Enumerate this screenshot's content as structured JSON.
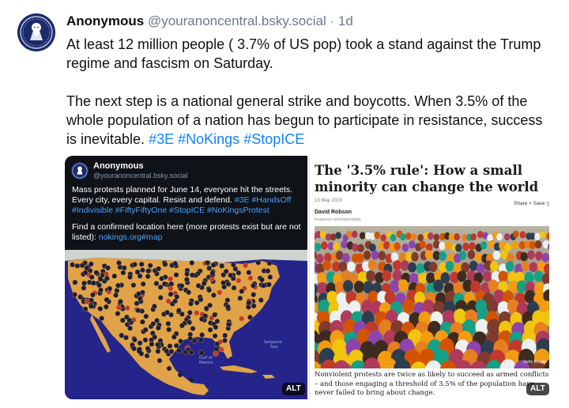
{
  "post": {
    "author_name": "Anonymous",
    "author_handle": "@youranoncentral.bsky.social",
    "separator": "·",
    "timestamp": "1d",
    "paragraph_1": "At least 12 million people ( 3.7% of US pop) took a stand against the Trump regime and fascism on Saturday.",
    "paragraph_2_text": "The next step is a national general strike and boycotts. When 3.5% of the whole population of a nation has begun to participate in resistance, success is inevitable.",
    "hashtags": [
      "#3E",
      "#NoKings",
      "#StopICE"
    ]
  },
  "left_image": {
    "name": "Anonymous",
    "handle": "@youranoncentral.bsky.social",
    "line_1": "Mass protests planned for June 14, everyone hit the streets. Every city, every capital. Resist and defend.",
    "line_1_tags": "#3E #HandsOff #Indivisible #FiftyFiftyOne #StopICE #NoKingsProtest",
    "line_2": "Find a confirmed location here (more protests exist but are not listed):",
    "line_2_link": "nokings.org#map",
    "map_label_gulf": "Gulf of\nMexico",
    "map_label_sea": "Sargasso\nSea",
    "alt_label": "ALT"
  },
  "right_image": {
    "title": "The '3.5% rule': How a small minority can change the world",
    "date": "13 May 2019",
    "share_label": "Share",
    "save_label": "Save",
    "author": "David Robson",
    "author_role": "Features correspondent",
    "photo_credit": "Getty Images",
    "caption": "Nonviolent protests are twice as likely to succeed as armed conflicts – and those engaging a threshold of 3.5% of the population have never failed to bring about change.",
    "alt_label": "ALT"
  },
  "colors": {
    "hashtag": "#1083fe",
    "handle": "#6b7a8a",
    "dark_card": "#0f1217",
    "map_land": "#e0a347",
    "map_sea": "#2a2a8a"
  },
  "icons": [
    "anonymous-mask-icon",
    "share-icon",
    "bookmark-icon"
  ]
}
